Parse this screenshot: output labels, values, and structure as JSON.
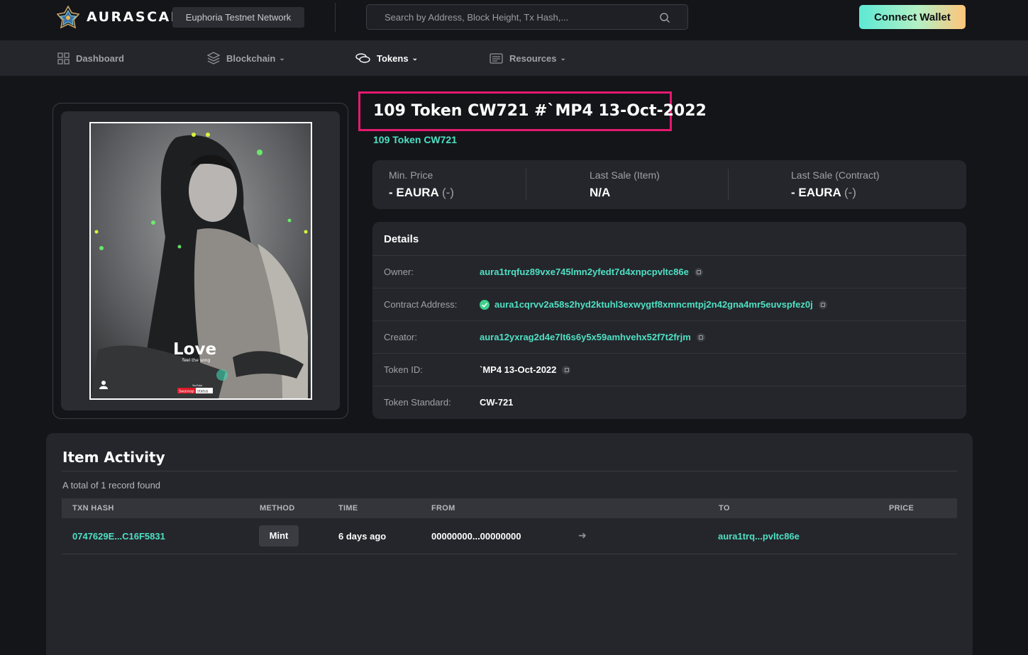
{
  "header": {
    "brand": "AURASCAN",
    "network": "Euphoria Testnet Network",
    "search_placeholder": "Search by Address, Block Height, Tx Hash,...",
    "connect_label": "Connect Wallet"
  },
  "nav": {
    "dashboard": "Dashboard",
    "blockchain": "Blockchain",
    "tokens": "Tokens",
    "resources": "Resources"
  },
  "image": {
    "overlay_title": "Love",
    "overlay_subtitle": "feel the song",
    "overlay_channel_small": "YouTube",
    "overlay_channel_left": "Swaroop",
    "overlay_channel_right": "status"
  },
  "token": {
    "title": "109 Token CW721 #`MP4 13-Oct-2022",
    "collection": "109 Token CW721"
  },
  "prices": {
    "min_label": "Min. Price",
    "min_value": "- EAURA",
    "min_muted": "(-)",
    "last_item_label": "Last Sale (Item)",
    "last_item_value": "N/A",
    "last_contract_label": "Last Sale (Contract)",
    "last_contract_value": "- EAURA",
    "last_contract_muted": "(-)"
  },
  "details": {
    "heading": "Details",
    "owner_label": "Owner:",
    "owner_value": "aura1trqfuz89vxe745lmn2yfedt7d4xnpcpvltc86e",
    "contract_label": "Contract Address:",
    "contract_value": "aura1cqrvv2a58s2hyd2ktuhl3exwygtf8xmncmtpj2n42gna4mr5euvspfez0j",
    "creator_label": "Creator:",
    "creator_value": "aura12yxrag2d4e7lt6s6y5x59amhvehx52f7t2frjm",
    "tokenid_label": "Token ID:",
    "tokenid_value": "`MP4 13-Oct-2022",
    "standard_label": "Token Standard:",
    "standard_value": "CW-721"
  },
  "activity": {
    "title": "Item Activity",
    "record_count": "A total of 1 record found",
    "columns": [
      "TXN HASH",
      "METHOD",
      "TIME",
      "FROM",
      "TO",
      "PRICE"
    ],
    "rows": [
      {
        "hash": "0747629E...C16F5831",
        "method": "Mint",
        "time": "6 days ago",
        "from": "00000000...00000000",
        "to": "aura1trq...pvltc86e",
        "price": ""
      }
    ]
  },
  "colors": {
    "accent": "#4fe0c4",
    "highlight": "#e5196f",
    "background": "#141519",
    "panel": "#24262b"
  }
}
